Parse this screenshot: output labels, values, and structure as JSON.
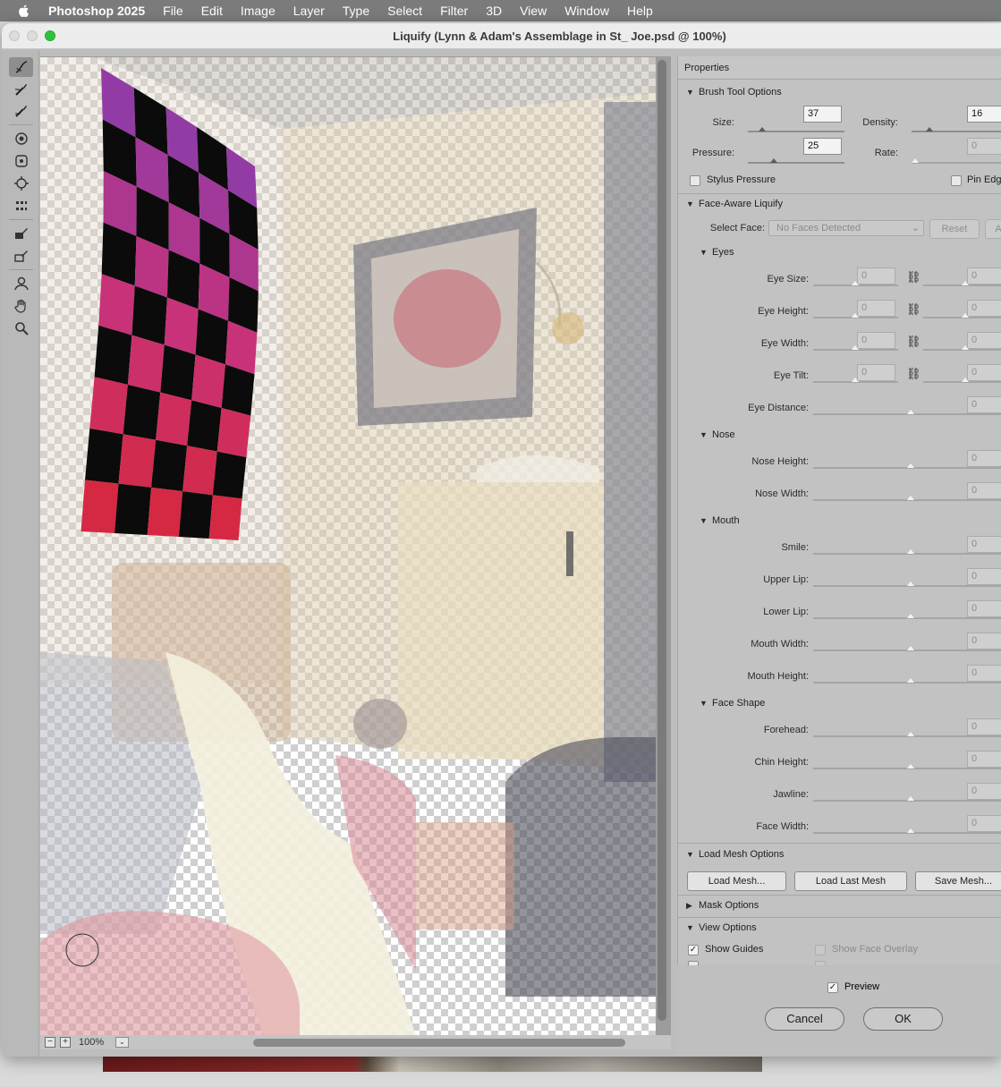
{
  "menubar": {
    "app": "Photoshop 2025",
    "items": [
      "File",
      "Edit",
      "Image",
      "Layer",
      "Type",
      "Select",
      "Filter",
      "3D",
      "View",
      "Window",
      "Help"
    ]
  },
  "window": {
    "title": "Liquify (Lynn & Adam's Assemblage in St_ Joe.psd @ 100%)"
  },
  "tools": [
    {
      "name": "forward-warp-tool-icon",
      "active": true
    },
    {
      "name": "reconstruct-tool-icon"
    },
    {
      "name": "smooth-tool-icon"
    },
    {
      "name": "twirl-tool-icon"
    },
    {
      "name": "pucker-tool-icon"
    },
    {
      "name": "bloat-tool-icon"
    },
    {
      "name": "push-left-tool-icon"
    },
    {
      "name": "freeze-mask-tool-icon"
    },
    {
      "name": "thaw-mask-tool-icon"
    },
    {
      "name": "face-tool-icon"
    },
    {
      "name": "hand-tool-icon"
    },
    {
      "name": "zoom-tool-icon"
    }
  ],
  "canvas": {
    "zoom": "100%",
    "zoom_out": "−",
    "zoom_in": "+",
    "zoom_drop": "⌄"
  },
  "properties": {
    "title": "Properties",
    "brush": {
      "header": "Brush Tool Options",
      "size_label": "Size:",
      "size": "37",
      "size_level": 0.12,
      "density_label": "Density:",
      "density": "16",
      "density_level": 0.16,
      "pressure_label": "Pressure:",
      "pressure": "25",
      "pressure_level": 0.25,
      "rate_label": "Rate:",
      "rate": "0",
      "rate_level": 0.0,
      "stylus_label": "Stylus Pressure",
      "pin_label": "Pin Edg"
    },
    "face": {
      "header": "Face-Aware Liquify",
      "select_face_label": "Select Face:",
      "select_face_value": "No Faces Detected",
      "reset_label": "Reset",
      "all_label": "A",
      "eyes": {
        "header": "Eyes",
        "rows": [
          {
            "label": "Eye Size:",
            "left": "0",
            "right": "0"
          },
          {
            "label": "Eye Height:",
            "left": "0",
            "right": "0"
          },
          {
            "label": "Eye Width:",
            "left": "0",
            "right": "0"
          },
          {
            "label": "Eye Tilt:",
            "left": "0",
            "right": "0"
          }
        ],
        "distance_label": "Eye Distance:",
        "distance": "0",
        "link_icon": "⛓"
      },
      "nose": {
        "header": "Nose",
        "rows": [
          {
            "label": "Nose Height:",
            "value": "0"
          },
          {
            "label": "Nose Width:",
            "value": "0"
          }
        ]
      },
      "mouth": {
        "header": "Mouth",
        "rows": [
          {
            "label": "Smile:",
            "value": "0"
          },
          {
            "label": "Upper Lip:",
            "value": "0"
          },
          {
            "label": "Lower Lip:",
            "value": "0"
          },
          {
            "label": "Mouth Width:",
            "value": "0"
          },
          {
            "label": "Mouth Height:",
            "value": "0"
          }
        ]
      },
      "shape": {
        "header": "Face Shape",
        "rows": [
          {
            "label": "Forehead:",
            "value": "0"
          },
          {
            "label": "Chin Height:",
            "value": "0"
          },
          {
            "label": "Jawline:",
            "value": "0"
          },
          {
            "label": "Face Width:",
            "value": "0"
          }
        ]
      }
    },
    "mesh": {
      "header": "Load Mesh Options",
      "load_label": "Load Mesh...",
      "load_last_label": "Load Last Mesh",
      "save_label": "Save Mesh..."
    },
    "mask": {
      "header": "Mask Options"
    },
    "view": {
      "header": "View Options",
      "show_guides_label": "Show Guides",
      "show_guides": true,
      "show_face_overlay_label": "Show Face Overlay",
      "show_face_overlay": false
    }
  },
  "footer": {
    "preview_label": "Preview",
    "preview": true,
    "cancel_label": "Cancel",
    "ok_label": "OK"
  }
}
